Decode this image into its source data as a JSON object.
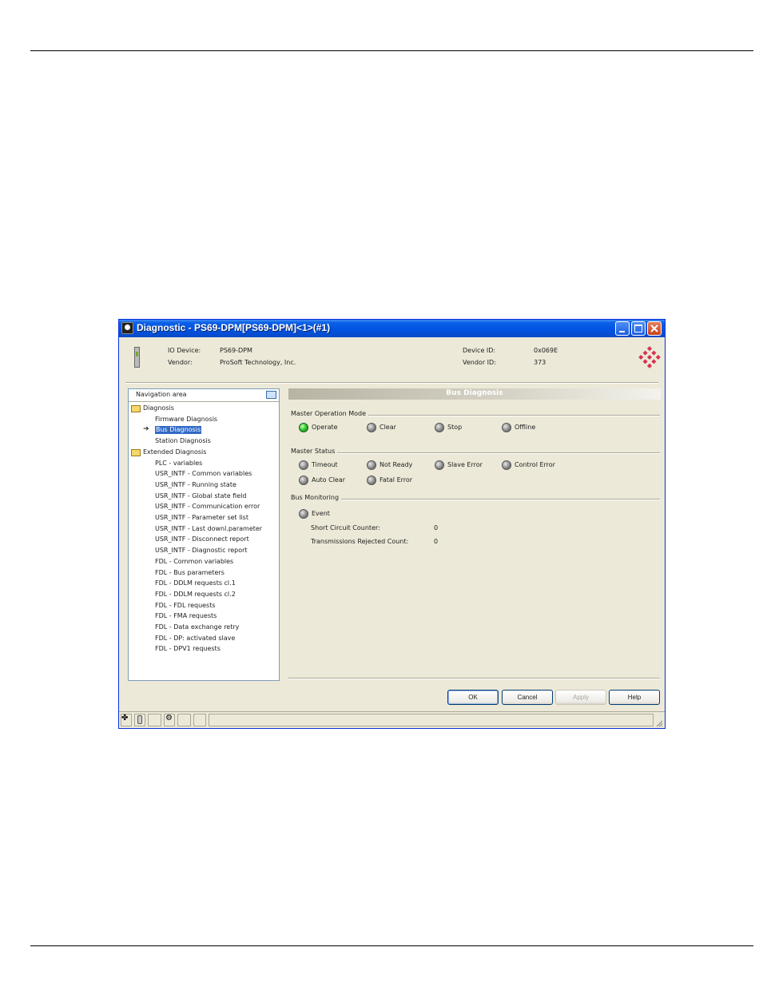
{
  "window": {
    "title": "Diagnostic - PS69-DPM[PS69-DPM]<1>(#1)"
  },
  "device_info": {
    "io_device_label": "IO Device:",
    "io_device_value": "PS69-DPM",
    "vendor_label": "Vendor:",
    "vendor_value": "ProSoft Technology, Inc.",
    "device_id_label": "Device ID:",
    "device_id_value": "0x069E",
    "vendor_id_label": "Vendor ID:",
    "vendor_id_value": "373"
  },
  "navigation": {
    "header": "Navigation area",
    "items": [
      {
        "label": "Diagnosis",
        "level": 0,
        "folder": true
      },
      {
        "label": "Firmware Diagnosis",
        "level": 1
      },
      {
        "label": "Bus Diagnosis",
        "level": 1,
        "selected": true
      },
      {
        "label": "Station Diagnosis",
        "level": 1
      },
      {
        "label": "Extended Diagnosis",
        "level": 0,
        "folder": true
      },
      {
        "label": "PLC - variables",
        "level": 1
      },
      {
        "label": "USR_INTF - Common variables",
        "level": 1
      },
      {
        "label": "USR_INTF - Running state",
        "level": 1
      },
      {
        "label": "USR_INTF - Global state field",
        "level": 1
      },
      {
        "label": "USR_INTF - Communication error",
        "level": 1
      },
      {
        "label": "USR_INTF - Parameter set list",
        "level": 1
      },
      {
        "label": "USR_INTF - Last downl.parameter",
        "level": 1
      },
      {
        "label": "USR_INTF - Disconnect report",
        "level": 1
      },
      {
        "label": "USR_INTF - Diagnostic report",
        "level": 1
      },
      {
        "label": "FDL - Common variables",
        "level": 1
      },
      {
        "label": "FDL - Bus parameters",
        "level": 1
      },
      {
        "label": "FDL - DDLM requests cl.1",
        "level": 1
      },
      {
        "label": "FDL - DDLM requests cl.2",
        "level": 1
      },
      {
        "label": "FDL - FDL requests",
        "level": 1
      },
      {
        "label": "FDL - FMA requests",
        "level": 1
      },
      {
        "label": "FDL - Data exchange retry",
        "level": 1
      },
      {
        "label": "FDL - DP: activated slave",
        "level": 1
      },
      {
        "label": "FDL - DPV1 requests",
        "level": 1
      }
    ]
  },
  "panel": {
    "title": "Bus Diagnosis",
    "master_operation_mode": {
      "title": "Master Operation Mode",
      "items": [
        {
          "label": "Operate",
          "on": true
        },
        {
          "label": "Clear",
          "on": false
        },
        {
          "label": "Stop",
          "on": false
        },
        {
          "label": "Offline",
          "on": false
        }
      ]
    },
    "master_status": {
      "title": "Master Status",
      "items": [
        {
          "label": "Timeout",
          "on": false
        },
        {
          "label": "Not Ready",
          "on": false
        },
        {
          "label": "Slave Error",
          "on": false
        },
        {
          "label": "Control Error",
          "on": false
        },
        {
          "label": "Auto Clear",
          "on": false
        },
        {
          "label": "Fatal Error",
          "on": false
        }
      ]
    },
    "bus_monitoring": {
      "title": "Bus Monitoring",
      "event_label": "Event",
      "event_on": false,
      "short_circuit_label": "Short Circuit Counter:",
      "short_circuit_value": "0",
      "transmissions_rejected_label": "Transmissions Rejected Count:",
      "transmissions_rejected_value": "0"
    }
  },
  "buttons": {
    "ok": "OK",
    "cancel": "Cancel",
    "apply": "Apply",
    "help": "Help"
  },
  "colors": {
    "led_on": "#28c728",
    "led_off": "#8a8a8a",
    "selection": "#316ac5",
    "titlebar": "#0053e1"
  }
}
